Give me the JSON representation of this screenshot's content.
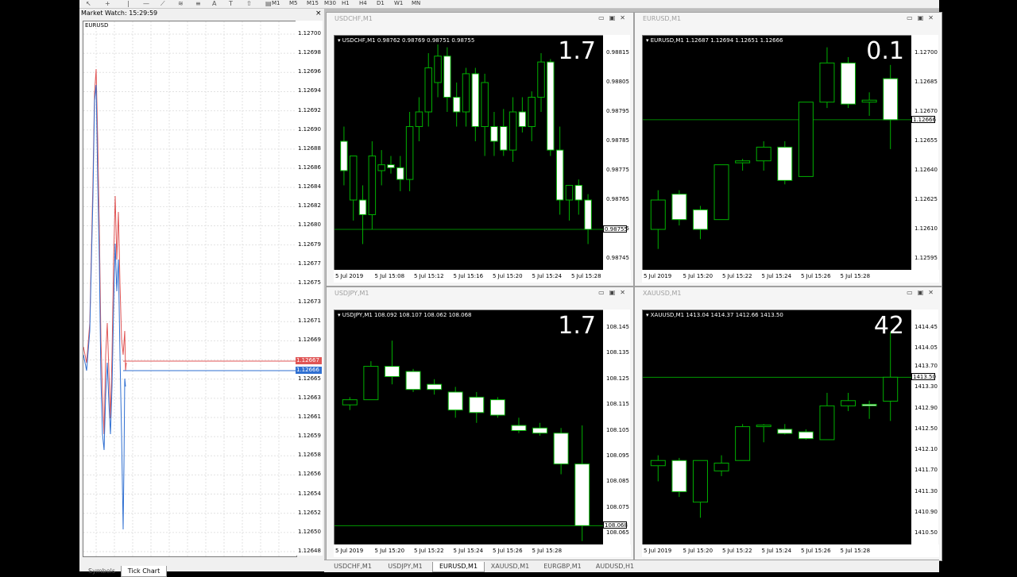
{
  "toolbar": {
    "timeframes": [
      "M1",
      "M5",
      "M15",
      "M30",
      "H1",
      "H4",
      "D1",
      "W1",
      "MN"
    ]
  },
  "market_watch": {
    "title": "Market Watch: 15:29:59",
    "close_label": "×",
    "symbol": "EURUSD",
    "price_labels": [
      "1.12700",
      "1.12698",
      "1.12696",
      "1.12694",
      "1.12692",
      "1.12690",
      "1.12688",
      "1.12686",
      "1.12684",
      "1.12682",
      "1.12680",
      "1.12679",
      "1.12677",
      "1.12675",
      "1.12673",
      "1.12671",
      "1.12669",
      "1.12667",
      "1.12665",
      "1.12663",
      "1.12661",
      "1.12659",
      "1.12658",
      "1.12656",
      "1.12654",
      "1.12652",
      "1.12650",
      "1.12648"
    ],
    "ask_tag": "1.12667",
    "bid_tag": "1.12666",
    "ask_color": "#e05555",
    "bid_color": "#2f6fd1",
    "tabs": [
      {
        "label": "Symbols"
      },
      {
        "label": "Tick Chart"
      }
    ]
  },
  "charts": [
    {
      "id": "usdchf",
      "title": "USDCHF,M1",
      "header": "USDCHF,M1  0.98762 0.98769 0.98751 0.98755",
      "big": "1.7",
      "y_labels": [
        "0.98815",
        "0.98805",
        "0.98795",
        "0.98785",
        "0.98775",
        "0.98765",
        "0.98755",
        "0.98745"
      ],
      "current_tag": "0.98755",
      "x_labels": [
        "5 Jul 2019",
        "5 Jul 15:08",
        "5 Jul 15:12",
        "5 Jul 15:16",
        "5 Jul 15:20",
        "5 Jul 15:24",
        "5 Jul 15:28"
      ],
      "candles": [
        {
          "o": 0.98785,
          "h": 0.9879,
          "l": 0.9877,
          "c": 0.98775
        },
        {
          "o": 0.98765,
          "h": 0.9878,
          "l": 0.98758,
          "c": 0.9878
        },
        {
          "o": 0.98765,
          "h": 0.9877,
          "l": 0.9875,
          "c": 0.9876
        },
        {
          "o": 0.9876,
          "h": 0.98785,
          "l": 0.98755,
          "c": 0.9878
        },
        {
          "o": 0.98775,
          "h": 0.98782,
          "l": 0.9877,
          "c": 0.98777
        },
        {
          "o": 0.98777,
          "h": 0.9878,
          "l": 0.98774,
          "c": 0.98776
        },
        {
          "o": 0.98776,
          "h": 0.9878,
          "l": 0.98768,
          "c": 0.98772
        },
        {
          "o": 0.98772,
          "h": 0.98795,
          "l": 0.98768,
          "c": 0.9879
        },
        {
          "o": 0.9879,
          "h": 0.988,
          "l": 0.98785,
          "c": 0.98795
        },
        {
          "o": 0.98795,
          "h": 0.98815,
          "l": 0.9879,
          "c": 0.9881
        },
        {
          "o": 0.98805,
          "h": 0.98818,
          "l": 0.988,
          "c": 0.98814
        },
        {
          "o": 0.98814,
          "h": 0.98817,
          "l": 0.98795,
          "c": 0.988
        },
        {
          "o": 0.988,
          "h": 0.98805,
          "l": 0.9879,
          "c": 0.98795
        },
        {
          "o": 0.98795,
          "h": 0.9881,
          "l": 0.9879,
          "c": 0.98808
        },
        {
          "o": 0.98808,
          "h": 0.9881,
          "l": 0.98785,
          "c": 0.9879
        },
        {
          "o": 0.9879,
          "h": 0.98808,
          "l": 0.9878,
          "c": 0.98805
        },
        {
          "o": 0.9879,
          "h": 0.98795,
          "l": 0.9878,
          "c": 0.98785
        },
        {
          "o": 0.9879,
          "h": 0.98796,
          "l": 0.9878,
          "c": 0.98782
        },
        {
          "o": 0.98782,
          "h": 0.988,
          "l": 0.98778,
          "c": 0.98795
        },
        {
          "o": 0.98795,
          "h": 0.988,
          "l": 0.98788,
          "c": 0.9879
        },
        {
          "o": 0.9879,
          "h": 0.98802,
          "l": 0.98785,
          "c": 0.988
        },
        {
          "o": 0.988,
          "h": 0.98815,
          "l": 0.98795,
          "c": 0.98812
        },
        {
          "o": 0.98812,
          "h": 0.98813,
          "l": 0.9878,
          "c": 0.98782
        },
        {
          "o": 0.98782,
          "h": 0.9879,
          "l": 0.9876,
          "c": 0.98765
        },
        {
          "o": 0.98765,
          "h": 0.9877,
          "l": 0.98758,
          "c": 0.9877
        },
        {
          "o": 0.9877,
          "h": 0.98772,
          "l": 0.9876,
          "c": 0.98765
        },
        {
          "o": 0.98765,
          "h": 0.98767,
          "l": 0.9875,
          "c": 0.98755
        }
      ]
    },
    {
      "id": "eurusd",
      "title": "EURUSD,M1",
      "header": "EURUSD,M1  1.12687 1.12694 1.12651 1.12666",
      "big": "0.1",
      "y_labels": [
        "1.12700",
        "1.12685",
        "1.12670",
        "1.12655",
        "1.12640",
        "1.12625",
        "1.12610",
        "1.12595"
      ],
      "current_tag": "1.12666",
      "x_labels": [
        "5 Jul 2019",
        "5 Jul 15:20",
        "5 Jul 15:22",
        "5 Jul 15:24",
        "5 Jul 15:26",
        "5 Jul 15:28"
      ],
      "candles": [
        {
          "o": 1.1261,
          "h": 1.1263,
          "l": 1.126,
          "c": 1.12625
        },
        {
          "o": 1.12628,
          "h": 1.1263,
          "l": 1.12612,
          "c": 1.12615
        },
        {
          "o": 1.1262,
          "h": 1.12622,
          "l": 1.12605,
          "c": 1.1261
        },
        {
          "o": 1.12615,
          "h": 1.12643,
          "l": 1.12615,
          "c": 1.12643
        },
        {
          "o": 1.12644,
          "h": 1.12646,
          "l": 1.1264,
          "c": 1.12645
        },
        {
          "o": 1.12645,
          "h": 1.12655,
          "l": 1.1264,
          "c": 1.12652
        },
        {
          "o": 1.12652,
          "h": 1.12655,
          "l": 1.12633,
          "c": 1.12635
        },
        {
          "o": 1.12637,
          "h": 1.12675,
          "l": 1.12637,
          "c": 1.12675
        },
        {
          "o": 1.12675,
          "h": 1.12703,
          "l": 1.12672,
          "c": 1.12695
        },
        {
          "o": 1.12695,
          "h": 1.12698,
          "l": 1.12672,
          "c": 1.12674
        },
        {
          "o": 1.12675,
          "h": 1.1268,
          "l": 1.12668,
          "c": 1.12676
        },
        {
          "o": 1.12687,
          "h": 1.12694,
          "l": 1.12651,
          "c": 1.12666
        }
      ]
    },
    {
      "id": "usdjpy",
      "title": "USDJPY,M1",
      "header": "USDJPY,M1  108.092 108.107 108.062 108.068",
      "big": "1.7",
      "y_labels": [
        "108.145",
        "108.135",
        "108.125",
        "108.115",
        "108.105",
        "108.095",
        "108.085",
        "108.075",
        "108.065"
      ],
      "current_tag": "108.068",
      "x_labels": [
        "5 Jul 2019",
        "5 Jul 15:20",
        "5 Jul 15:22",
        "5 Jul 15:24",
        "5 Jul 15:26",
        "5 Jul 15:28"
      ],
      "candles": [
        {
          "o": 108.115,
          "h": 108.118,
          "l": 108.113,
          "c": 108.117
        },
        {
          "o": 108.117,
          "h": 108.132,
          "l": 108.117,
          "c": 108.13
        },
        {
          "o": 108.13,
          "h": 108.14,
          "l": 108.123,
          "c": 108.126
        },
        {
          "o": 108.128,
          "h": 108.129,
          "l": 108.12,
          "c": 108.121
        },
        {
          "o": 108.123,
          "h": 108.125,
          "l": 108.119,
          "c": 108.121
        },
        {
          "o": 108.12,
          "h": 108.122,
          "l": 108.11,
          "c": 108.113
        },
        {
          "o": 108.118,
          "h": 108.12,
          "l": 108.108,
          "c": 108.112
        },
        {
          "o": 108.117,
          "h": 108.118,
          "l": 108.11,
          "c": 108.111
        },
        {
          "o": 108.107,
          "h": 108.11,
          "l": 108.104,
          "c": 108.105
        },
        {
          "o": 108.106,
          "h": 108.108,
          "l": 108.103,
          "c": 108.104
        },
        {
          "o": 108.104,
          "h": 108.106,
          "l": 108.088,
          "c": 108.092
        },
        {
          "o": 108.092,
          "h": 108.107,
          "l": 108.062,
          "c": 108.068
        }
      ]
    },
    {
      "id": "xauusd",
      "title": "XAUUSD,M1",
      "header": "XAUUSD,M1  1413.04 1414.37 1412.66 1413.50",
      "big": "42",
      "y_labels": [
        "1414.45",
        "1414.05",
        "1413.70",
        "1413.30",
        "1412.90",
        "1412.50",
        "1412.10",
        "1411.70",
        "1411.30",
        "1410.90",
        "1410.50"
      ],
      "current_tag": "1413.50",
      "x_labels": [
        "5 Jul 2019",
        "5 Jul 15:20",
        "5 Jul 15:22",
        "5 Jul 15:24",
        "5 Jul 15:26",
        "5 Jul 15:28"
      ],
      "candles": [
        {
          "o": 1411.8,
          "h": 1412.0,
          "l": 1411.5,
          "c": 1411.9
        },
        {
          "o": 1411.9,
          "h": 1411.95,
          "l": 1411.2,
          "c": 1411.3
        },
        {
          "o": 1411.1,
          "h": 1411.9,
          "l": 1410.8,
          "c": 1411.9
        },
        {
          "o": 1411.7,
          "h": 1412.0,
          "l": 1411.6,
          "c": 1411.85
        },
        {
          "o": 1411.9,
          "h": 1412.6,
          "l": 1411.9,
          "c": 1412.55
        },
        {
          "o": 1412.55,
          "h": 1412.6,
          "l": 1412.25,
          "c": 1412.58
        },
        {
          "o": 1412.5,
          "h": 1412.6,
          "l": 1412.4,
          "c": 1412.42
        },
        {
          "o": 1412.45,
          "h": 1412.5,
          "l": 1412.3,
          "c": 1412.32
        },
        {
          "o": 1412.3,
          "h": 1413.2,
          "l": 1412.3,
          "c": 1412.95
        },
        {
          "o": 1412.95,
          "h": 1413.2,
          "l": 1412.85,
          "c": 1413.05
        },
        {
          "o": 1412.98,
          "h": 1413.05,
          "l": 1412.7,
          "c": 1412.95
        },
        {
          "o": 1413.04,
          "h": 1414.37,
          "l": 1412.66,
          "c": 1413.5
        }
      ]
    }
  ],
  "bottom_tabs": [
    {
      "label": "USDCHF,M1"
    },
    {
      "label": "USDJPY,M1"
    },
    {
      "label": "EURUSD,M1",
      "active": true
    },
    {
      "label": "XAUUSD,M1"
    },
    {
      "label": "EURGBP,M1"
    },
    {
      "label": "AUDUSD,H1"
    }
  ],
  "colors": {
    "candle_line": "#00b000",
    "bull_fill": "#000000",
    "bear_fill": "#ffffff",
    "price_line": "#00b000"
  }
}
